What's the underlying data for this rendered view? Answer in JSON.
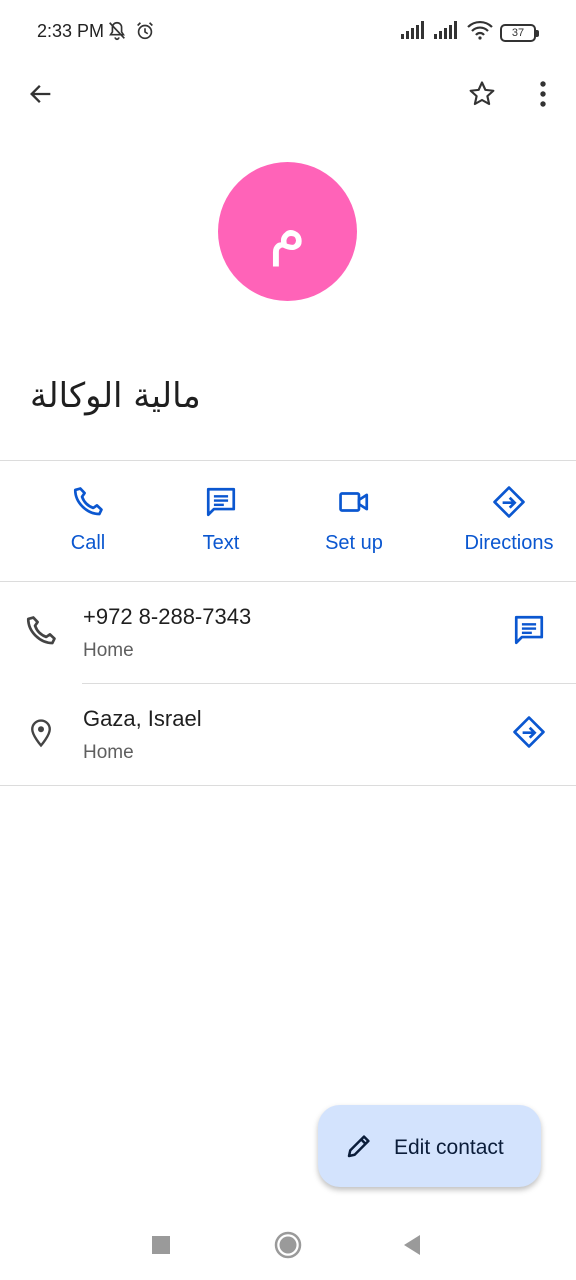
{
  "status_bar": {
    "time": "2:33 PM",
    "battery": "37",
    "icons": [
      "bell-off-icon",
      "alarm-icon",
      "signal-icon",
      "signal-icon",
      "wifi-icon",
      "battery-icon"
    ]
  },
  "app_bar": {
    "icons": [
      "arrow-back-icon",
      "star-outline-icon",
      "more-vert-icon"
    ]
  },
  "contact": {
    "avatar_letter": "م",
    "avatar_color": "#ff63b8",
    "name": "مالية الوكالة"
  },
  "actions": [
    {
      "label": "Call",
      "icon": "phone-icon"
    },
    {
      "label": "Text",
      "icon": "message-icon"
    },
    {
      "label": "Set up",
      "icon": "videocam-icon"
    },
    {
      "label": "Directions",
      "icon": "directions-icon"
    }
  ],
  "details": {
    "phone": {
      "value": "+972 8-288-7343",
      "type": "Home"
    },
    "address": {
      "value": "Gaza, Israel",
      "type": "Home"
    }
  },
  "fab": {
    "label": "Edit contact",
    "icon": "edit-pencil-icon"
  },
  "colors": {
    "accent": "#0b57d0",
    "fab_bg": "#d3e3fd",
    "divider": "#dcdcdc"
  },
  "nav_bar": {
    "icons": [
      "recents-square-icon",
      "home-circle-icon",
      "back-triangle-icon"
    ]
  }
}
